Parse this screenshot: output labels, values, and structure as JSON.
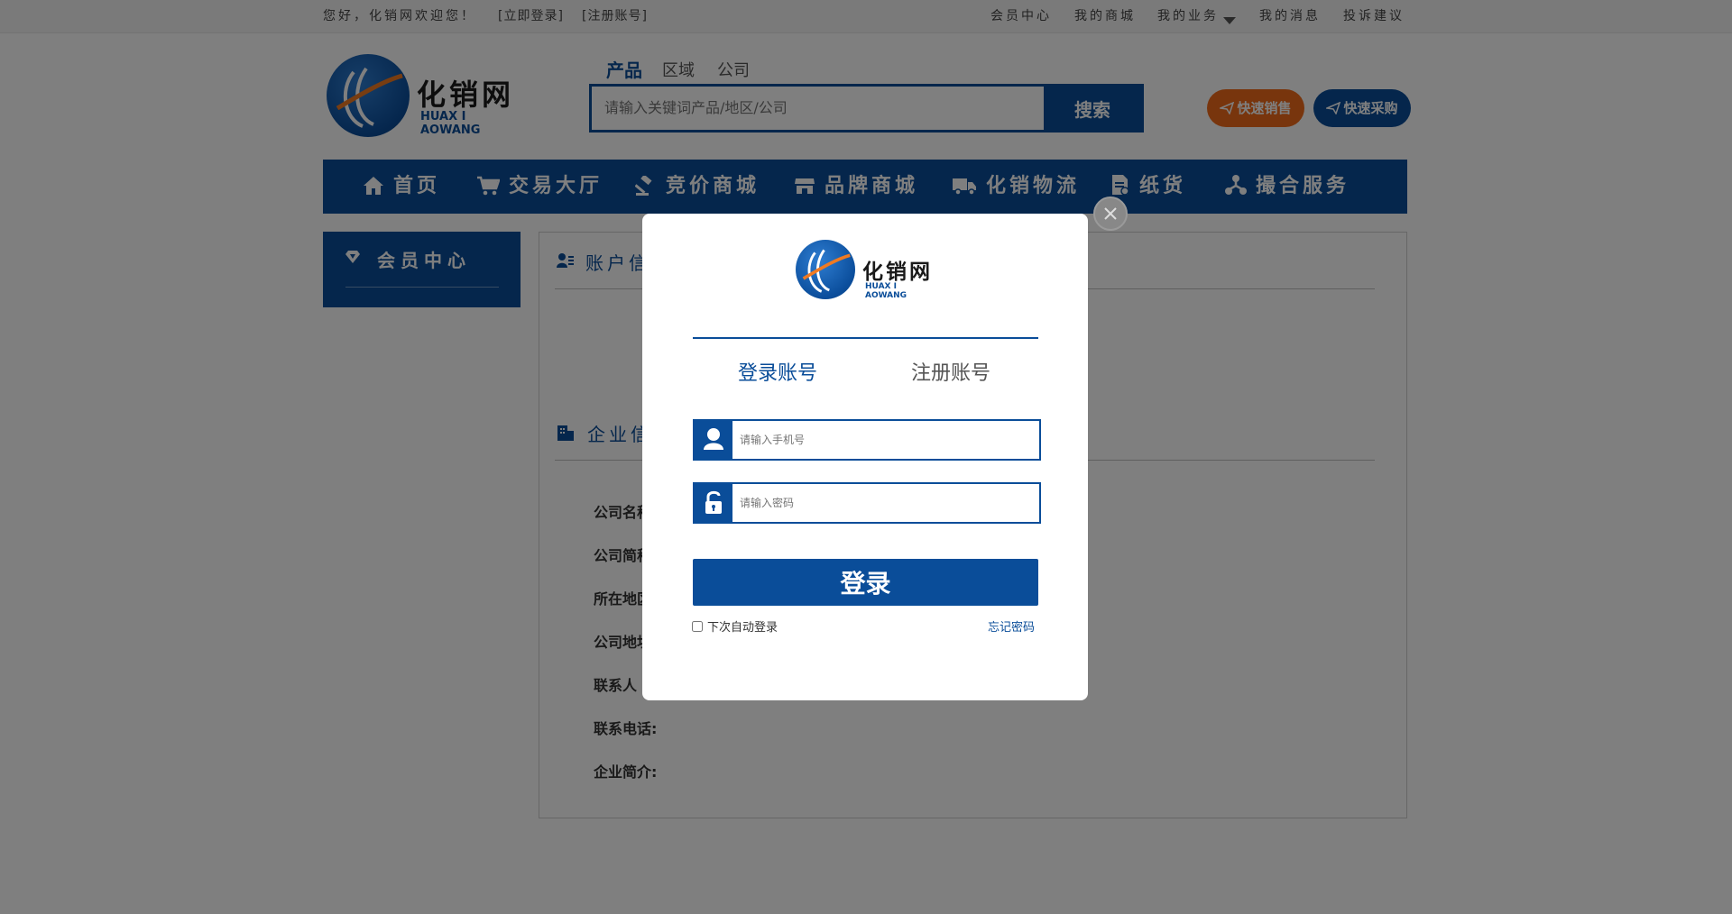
{
  "topbar": {
    "welcome": "您好，化销网欢迎您！",
    "login_link": "[立即登录]",
    "register_link": "[注册账号]",
    "links": [
      "会员中心",
      "我的商城",
      "我的业务",
      "我的消息",
      "投诉建议"
    ]
  },
  "logo": {
    "name": "化销网",
    "pinyin": "HUAX I AOWANG"
  },
  "search": {
    "tabs": [
      "产品",
      "区域",
      "公司"
    ],
    "active_tab": "产品",
    "placeholder": "请输入关键词产品/地区/公司",
    "button": "搜索"
  },
  "quick": {
    "sell": "快速销售",
    "buy": "快速采购"
  },
  "nav": {
    "items": [
      {
        "label": "首页",
        "icon": "home-icon"
      },
      {
        "label": "交易大厅",
        "icon": "cart-icon"
      },
      {
        "label": "竞价商城",
        "icon": "gavel-icon"
      },
      {
        "label": "品牌商城",
        "icon": "store-icon"
      },
      {
        "label": "化销物流",
        "icon": "truck-icon"
      },
      {
        "label": "纸货",
        "icon": "document-icon"
      },
      {
        "label": "撮合服务",
        "icon": "network-icon"
      }
    ]
  },
  "sidebar": {
    "title": "会员中心",
    "icon": "diamond-icon"
  },
  "main": {
    "account_title": "账户信",
    "company_title": "企业信",
    "labels": [
      "公司名称",
      "公司简称",
      "所在地区",
      "公司地址",
      "联系人",
      "联系电话:",
      "企业简介:"
    ]
  },
  "modal": {
    "tabs": {
      "login": "登录账号",
      "register": "注册账号"
    },
    "phone_placeholder": "请输入手机号",
    "password_placeholder": "请输入密码",
    "login_button": "登录",
    "auto_login": "下次自动登录",
    "forgot": "忘记密码"
  },
  "colors": {
    "primary": "#0a4d99",
    "orange": "#f06a1a",
    "overlay": "rgba(0,0,0,0.5)"
  }
}
